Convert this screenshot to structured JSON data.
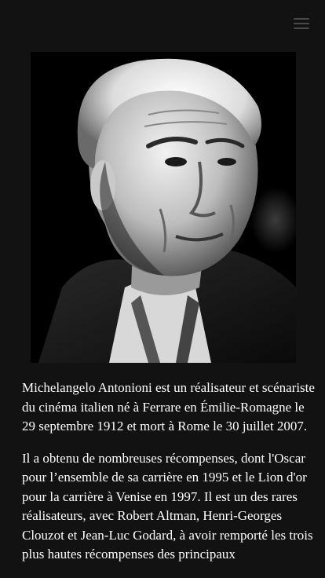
{
  "header": {
    "menu_icon": "hamburger-menu-icon"
  },
  "portrait": {
    "alt": "Michelangelo Antonioni"
  },
  "article": {
    "paragraphs": [
      "Michelangelo Antonioni est un réalisateur et scénariste du cinéma italien né à Ferrare en Émilie-Romagne le 29 septembre 1912 et mort à Rome le 30 juillet 2007.",
      "Il a obtenu de nombreuses récompenses, dont l'Oscar pour l’ensemble de sa carrière en 1995 et le Lion d'or pour la carrière à Venise en 1997. Il est un des rares réalisateurs, avec Robert Altman, Henri-Georges Clouzot et Jean-Luc Godard, à avoir remporté les trois plus hautes récompenses des principaux"
    ]
  }
}
